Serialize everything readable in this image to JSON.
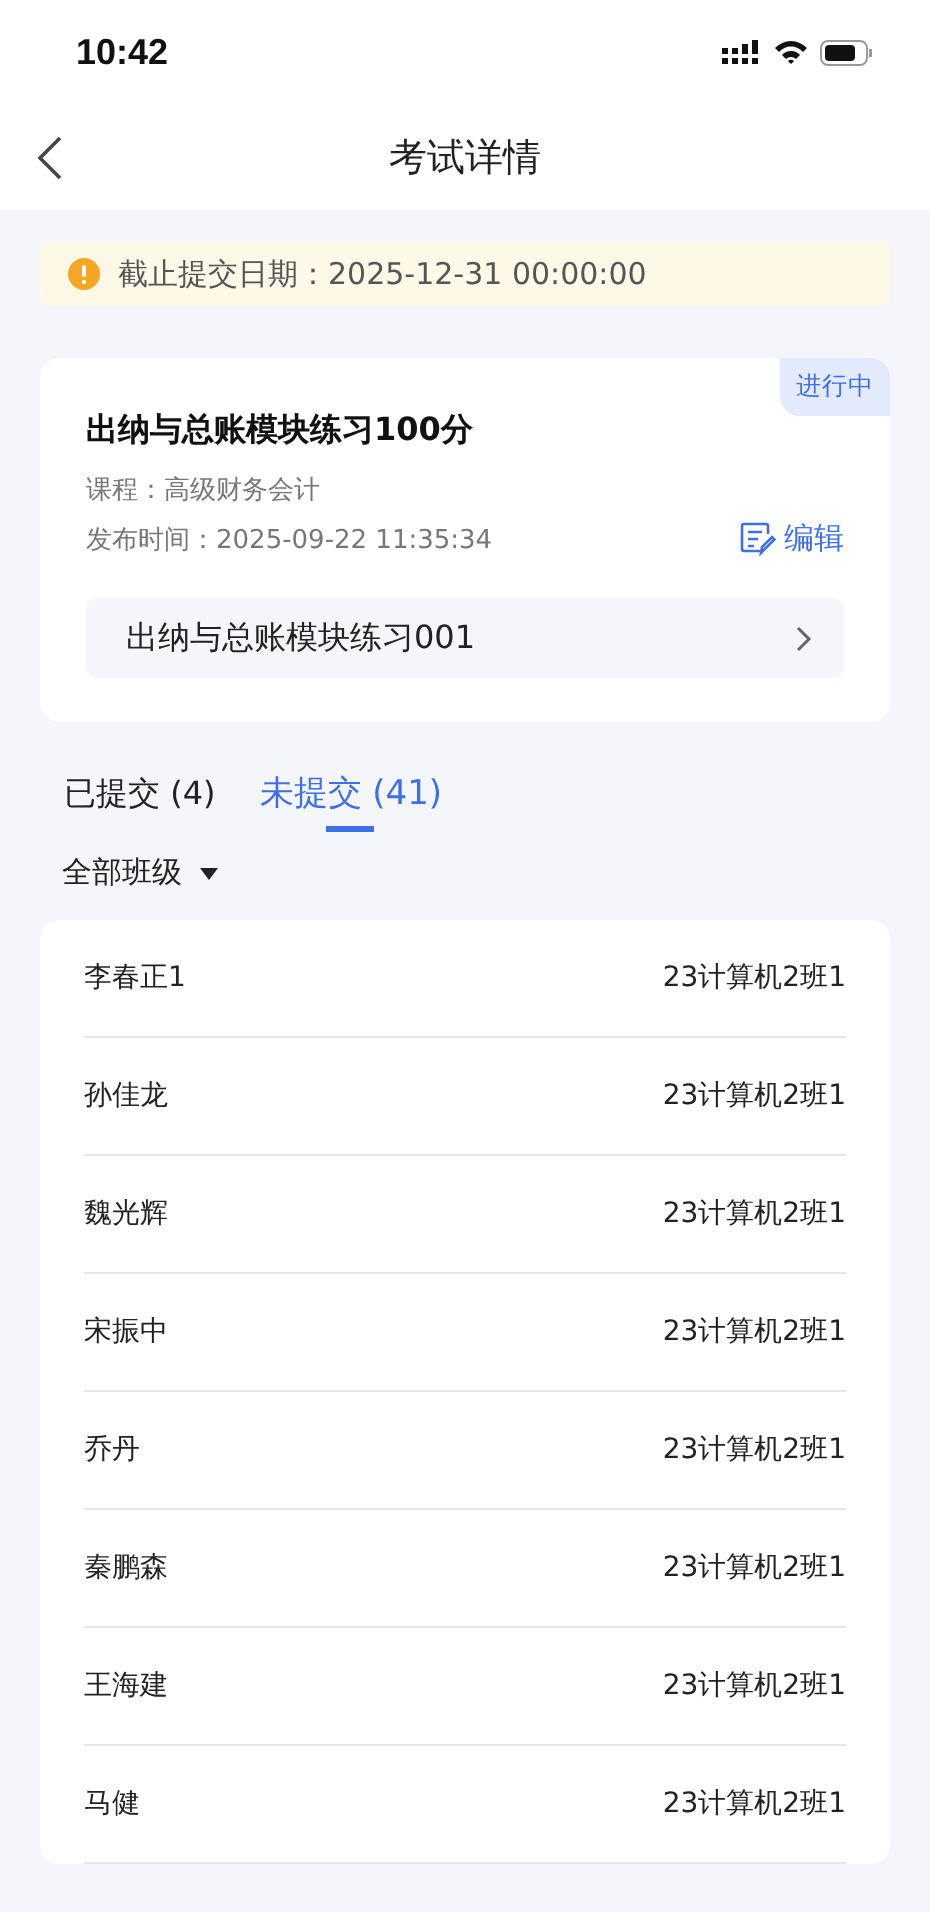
{
  "status_bar": {
    "time": "10:42"
  },
  "nav": {
    "title": "考试详情"
  },
  "notice": {
    "text": "截止提交日期：2025-12-31 00:00:00"
  },
  "exam": {
    "status": "进行中",
    "title": "出纳与总账模块练习100分",
    "course": "课程：高级财务会计",
    "published": "发布时间：2025-09-22 11:35:34",
    "edit": "编辑",
    "paper": "出纳与总账模块练习001"
  },
  "tabs": [
    {
      "label": "已提交 (4)",
      "selected": false
    },
    {
      "label": "未提交 (41)",
      "selected": true
    }
  ],
  "filter": {
    "label": "全部班级"
  },
  "students": [
    {
      "name": "李春正1",
      "class": "23计算机2班1"
    },
    {
      "name": "孙佳龙",
      "class": "23计算机2班1"
    },
    {
      "name": "魏光辉",
      "class": "23计算机2班1"
    },
    {
      "name": "宋振中",
      "class": "23计算机2班1"
    },
    {
      "name": "乔丹",
      "class": "23计算机2班1"
    },
    {
      "name": "秦鹏森",
      "class": "23计算机2班1"
    },
    {
      "name": "王海建",
      "class": "23计算机2班1"
    },
    {
      "name": "马健",
      "class": "23计算机2班1"
    }
  ]
}
